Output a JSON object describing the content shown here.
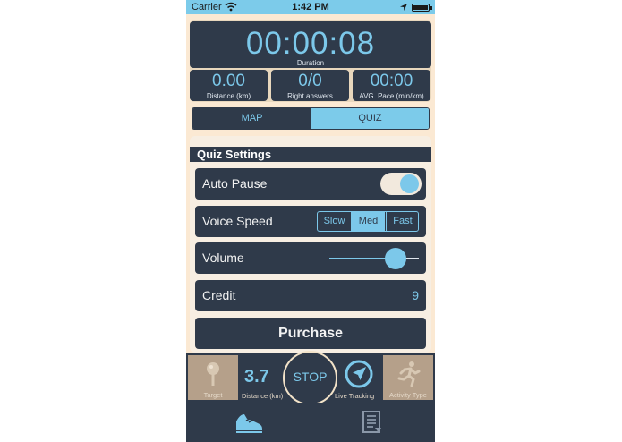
{
  "status_bar": {
    "carrier": "Carrier",
    "time": "1:42 PM"
  },
  "stats": {
    "duration": {
      "value": "00:00:08",
      "label": "Duration"
    },
    "distance": {
      "value": "0.00",
      "label": "Distance (km)"
    },
    "right_answers": {
      "value": "0/0",
      "label": "Right answers"
    },
    "pace": {
      "value": "00:00",
      "label": "AVG. Pace (min/km)"
    }
  },
  "view_tabs": {
    "map": "MAP",
    "quiz": "QUIZ",
    "selected": "QUIZ"
  },
  "quiz_settings": {
    "title": "Quiz Settings",
    "auto_pause": {
      "label": "Auto Pause",
      "on": true
    },
    "voice_speed": {
      "label": "Voice Speed",
      "options": [
        "Slow",
        "Med",
        "Fast"
      ],
      "selected": "Med"
    },
    "volume": {
      "label": "Volume",
      "level": 0.75
    },
    "credit": {
      "label": "Credit",
      "value": "9"
    },
    "purchase_label": "Purchase"
  },
  "activity_bar": {
    "target_label": "Target",
    "distance_value": "3.7",
    "distance_label": "Distance (km)",
    "stop_label": "STOP",
    "live_tracking_label": "Live Tracking",
    "activity_type_label": "Activity Type"
  },
  "tab_bar": {
    "items": [
      "run-shoe-icon",
      "log-list-icon"
    ],
    "selected": "run-shoe-icon"
  },
  "colors": {
    "accent": "#7cc8ea",
    "panel": "#2f3a4a",
    "background": "#fbe9d3"
  }
}
